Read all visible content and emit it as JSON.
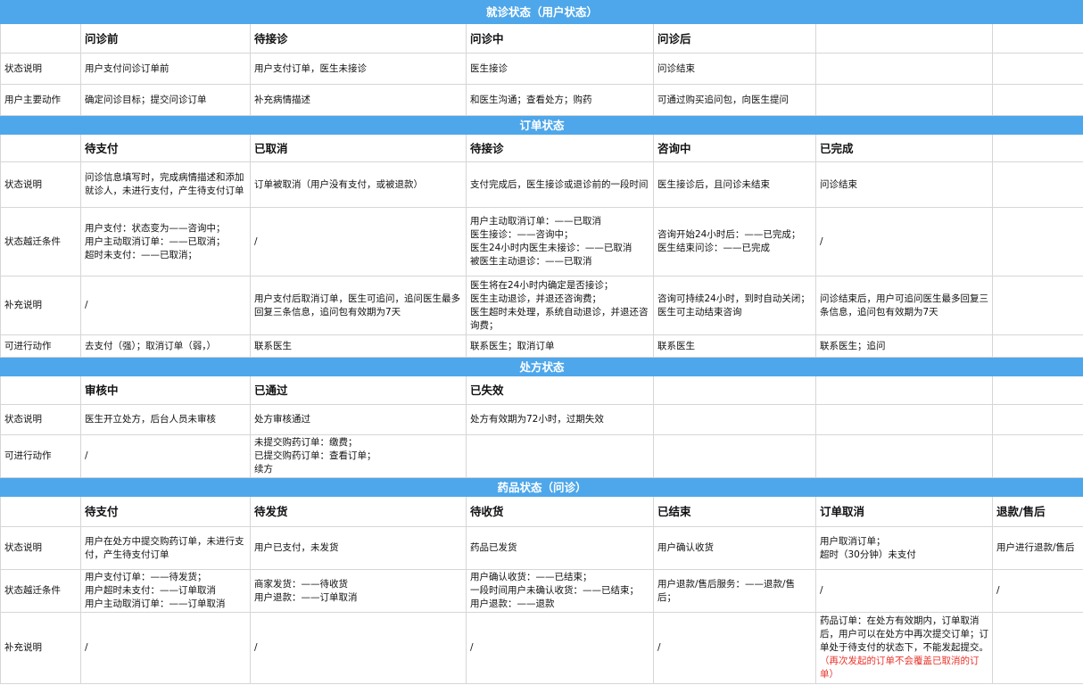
{
  "sections": {
    "visit": {
      "title": "就诊状态（用户状态）",
      "headers": [
        "问诊前",
        "待接诊",
        "问诊中",
        "问诊后"
      ],
      "rows": [
        {
          "label": "状态说明",
          "cells": [
            "用户支付问诊订单前",
            "用户支付订单，医生未接诊",
            "医生接诊",
            "问诊结束"
          ]
        },
        {
          "label": "用户主要动作",
          "cells": [
            "确定问诊目标；提交问诊订单",
            "补充病情描述",
            "和医生沟通；查看处方；购药",
            "可通过购买追问包，向医生提问"
          ]
        }
      ]
    },
    "order": {
      "title": "订单状态",
      "headers": [
        "待支付",
        "已取消",
        "待接诊",
        "咨询中",
        "已完成"
      ],
      "rows": [
        {
          "label": "状态说明",
          "cells": [
            "问诊信息填写时，完成病情描述和添加就诊人，未进行支付，产生待支付订单",
            "订单被取消（用户没有支付，或被退款）",
            "支付完成后，医生接诊或退诊前的一段时间",
            "医生接诊后，且问诊未结束",
            "问诊结束"
          ]
        },
        {
          "label": "状态越迁条件",
          "cells": [
            "用户支付：状态变为——咨询中；\n用户主动取消订单：——已取消；\n超时未支付：——已取消；",
            "/",
            "用户主动取消订单：——已取消\n医生接诊：——咨询中；\n医生24小时内医生未接诊：——已取消\n被医生主动退诊：——已取消",
            "咨询开始24小时后：——已完成；\n医生结束问诊：——已完成",
            "/"
          ]
        },
        {
          "label": "补充说明",
          "cells": [
            "/",
            "用户支付后取消订单，医生可追问，追问医生最多回复三条信息，追问包有效期为7天",
            "医生将在24小时内确定是否接诊；\n医生主动退诊，并退还咨询费；\n医生超时未处理，系统自动退诊，并退还咨询费；",
            "咨询可持续24小时，到时自动关闭；\n医生可主动结束咨询",
            "问诊结束后，用户可追问医生最多回复三条信息，追问包有效期为7天"
          ]
        },
        {
          "label": "可进行动作",
          "cells": [
            "去支付（强）；取消订单（弱，）",
            "联系医生",
            "联系医生；取消订单",
            "联系医生",
            "联系医生；追问"
          ]
        }
      ]
    },
    "prescription": {
      "title": "处方状态",
      "headers": [
        "审核中",
        "已通过",
        "已失效"
      ],
      "rows": [
        {
          "label": "状态说明",
          "cells": [
            "医生开立处方，后台人员未审核",
            "处方审核通过",
            "处方有效期为72小时，过期失效"
          ]
        },
        {
          "label": "可进行动作",
          "cells": [
            "/",
            "未提交购药订单：缴费；\n已提交购药订单：查看订单；\n续方",
            ""
          ]
        }
      ]
    },
    "drug": {
      "title": "药品状态（问诊）",
      "headers": [
        "待支付",
        "待发货",
        "待收货",
        "已结束",
        "订单取消",
        "退款/售后"
      ],
      "rows": [
        {
          "label": "状态说明",
          "cells": [
            "用户在处方中提交购药订单，未进行支付，产生待支付订单",
            "用户已支付，未发货",
            "药品已发货",
            "用户确认收货",
            "用户取消订单；\n超时（30分钟）未支付",
            "用户进行退款/售后"
          ]
        },
        {
          "label": "状态越迁条件",
          "cells": [
            "用户支付订单：——待发货；\n用户超时未支付：——订单取消\n用户主动取消订单：——订单取消",
            "商家发货：——待收货\n用户退款：——订单取消",
            "用户确认收货：——已结束；\n一段时间用户未确认收货：——已结束；\n用户退款：——退款",
            "用户退款/售后服务：——退款/售后；",
            "/",
            "/"
          ]
        },
        {
          "label": "补充说明",
          "cells": [
            "/",
            "/",
            "/",
            "/",
            "药品订单：在处方有效期内，订单取消后，用户可以在处方中再次提交订单；订单处于待支付的状态下，不能发起提交。",
            ""
          ],
          "note_red": "（再次发起的订单不会覆盖已取消的订单）"
        }
      ]
    }
  }
}
